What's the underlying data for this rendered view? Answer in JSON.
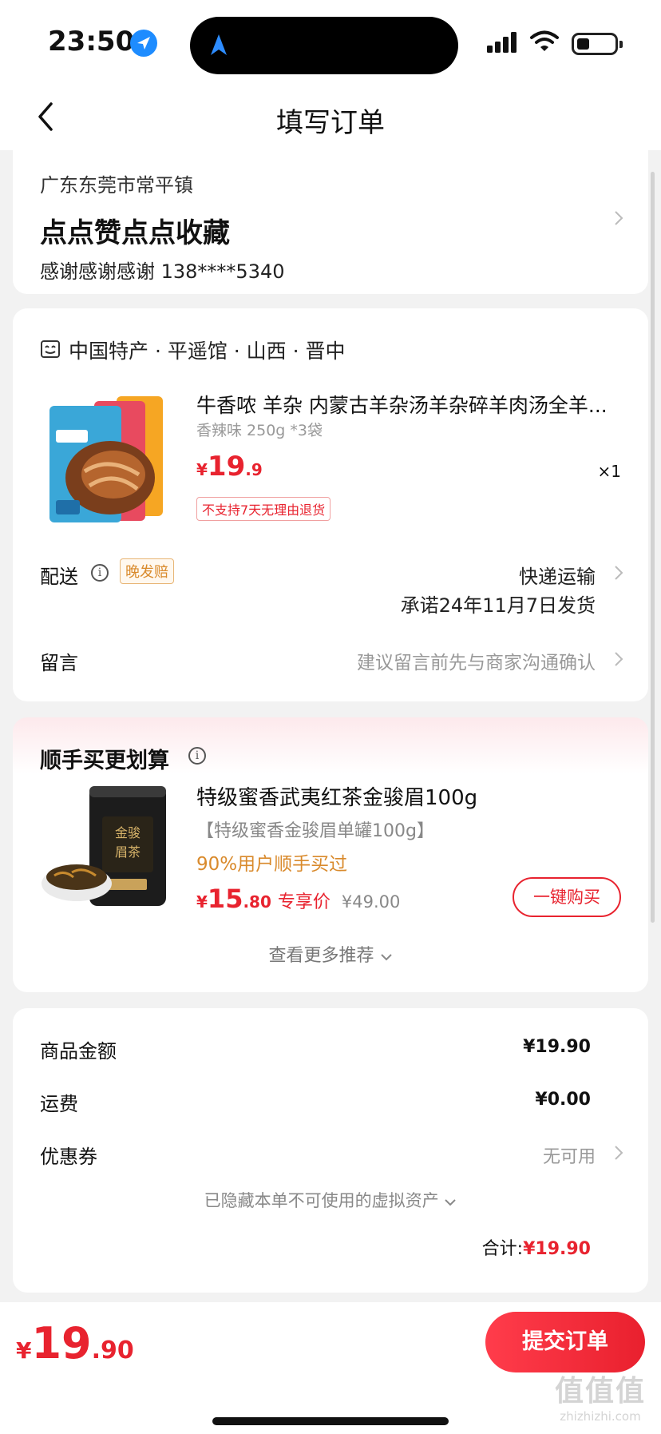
{
  "status_bar": {
    "time": "23:50"
  },
  "nav": {
    "title": "填写订单"
  },
  "address": {
    "region": "广东东莞市常平镇",
    "name": "点点赞点点收藏",
    "contact": "感谢感谢感谢  138****5340"
  },
  "shop": {
    "name": "中国特产 · 平遥馆 · 山西 · 晋中",
    "product": {
      "title": "牛香哝 羊杂 内蒙古羊杂汤羊杂碎羊肉汤全羊...",
      "spec": "香辣味 250g *3袋",
      "price_symbol": "¥",
      "price_int": "19",
      "price_dec": ".9",
      "quantity": "×1",
      "return_policy": "不支持7天无理由退货"
    },
    "delivery": {
      "label": "配送",
      "late_badge": "晚发赔",
      "method": "快递运输",
      "promise": "承诺24年11月7日发货"
    },
    "remark": {
      "label": "留言",
      "placeholder": "建议留言前先与商家沟通确认"
    }
  },
  "recommend": {
    "title": "顺手买更划算",
    "name": "特级蜜香武夷红茶金骏眉100g",
    "subtitle": "【特级蜜香金骏眉单罐100g】",
    "social": "90%用户顺手买过",
    "price_symbol": "¥",
    "price_int": "15",
    "price_dec": ".80",
    "exclusive": "专享价",
    "original_price": "¥49.00",
    "buy_button": "一键购买",
    "more": "查看更多推荐"
  },
  "summary": {
    "goods_label": "商品金额",
    "goods_value": "¥19.90",
    "shipping_label": "运费",
    "shipping_value": "¥0.00",
    "coupon_label": "优惠券",
    "coupon_value": "无可用",
    "hidden_assets": "已隐藏本单不可使用的虚拟资产",
    "total_label": "合计:",
    "total_value": "¥19.90"
  },
  "bottom_bar": {
    "price_symbol": "¥",
    "price_int": "19",
    "price_dec": ".90",
    "submit": "提交订单"
  },
  "watermark": {
    "big": "值值值",
    "small": "zhizhizhi.com"
  },
  "colors": {
    "accent": "#e8232f",
    "orange": "#d98a2c",
    "bg": "#f2f2f2"
  }
}
